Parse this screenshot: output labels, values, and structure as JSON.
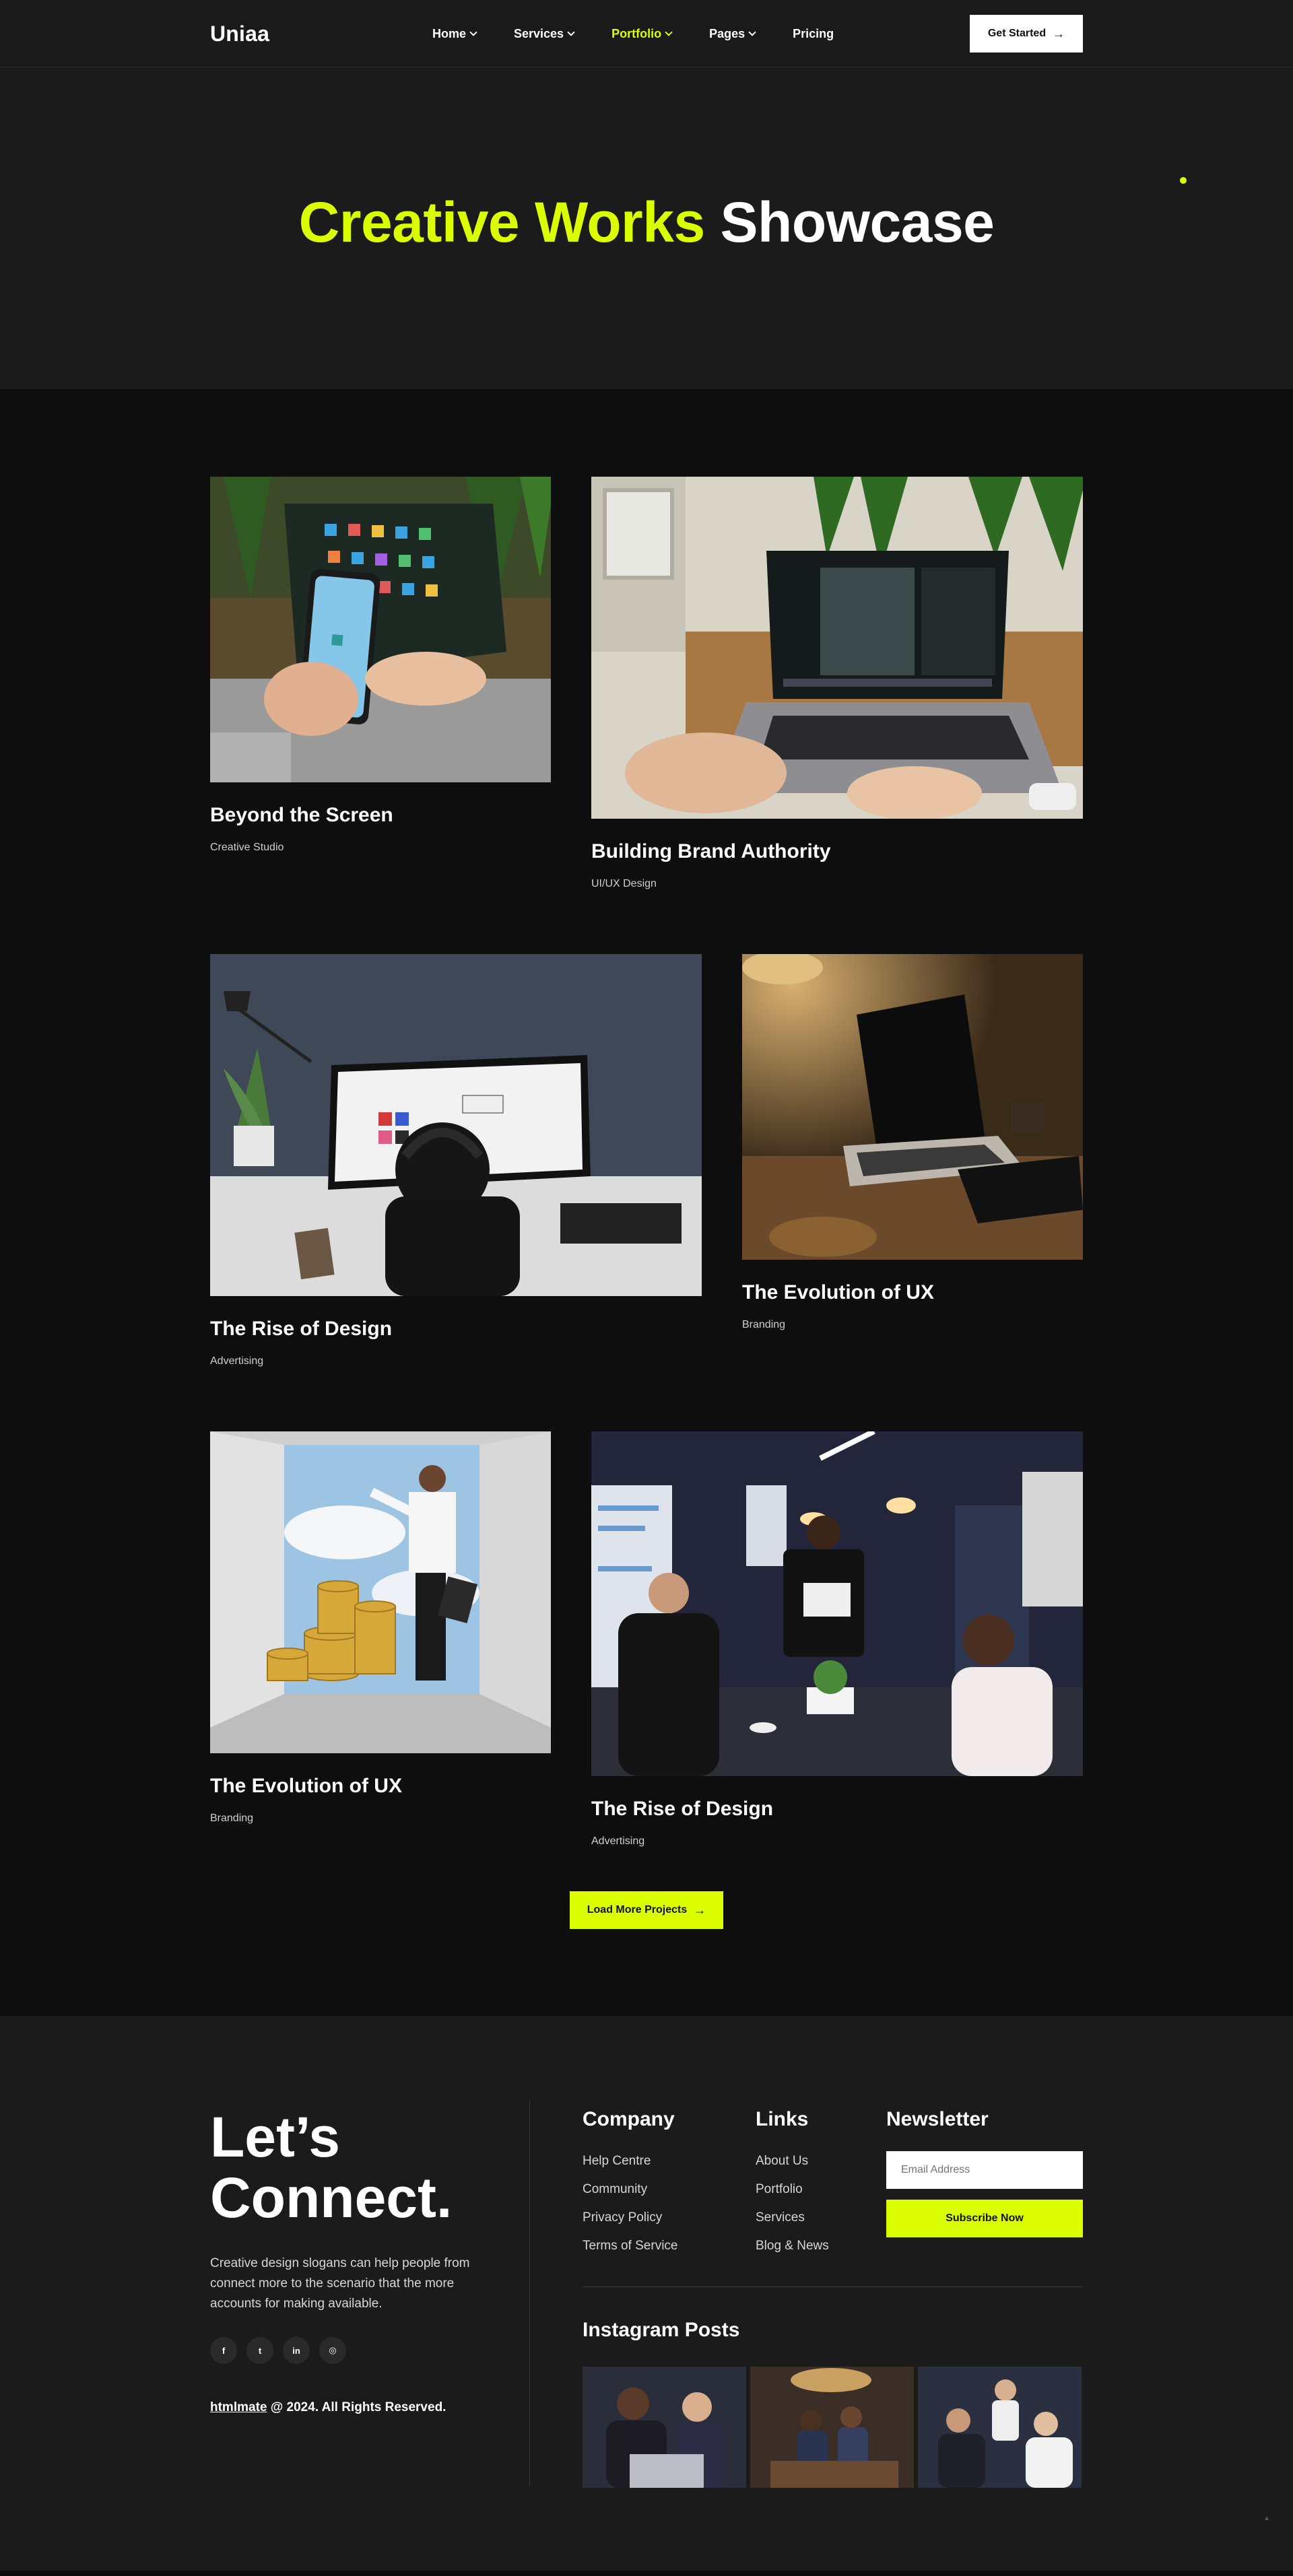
{
  "brand": {
    "logo": "Uniaa",
    "accent": "#dcff00",
    "bg_dark": "#0e0e0e",
    "bg_panel": "#1b1b1b"
  },
  "nav": {
    "items": [
      {
        "label": "Home",
        "dropdown": true,
        "active": false
      },
      {
        "label": "Services",
        "dropdown": true,
        "active": false
      },
      {
        "label": "Portfolio",
        "dropdown": true,
        "active": true
      },
      {
        "label": "Pages",
        "dropdown": true,
        "active": false
      },
      {
        "label": "Pricing",
        "dropdown": false,
        "active": false
      }
    ],
    "cta_label": "Get Started",
    "cta_icon": "arrow-right-icon"
  },
  "hero": {
    "title_accent": "Creative Works",
    "title_rest": "Showcase"
  },
  "portfolio": {
    "projects": [
      {
        "title": "Beyond the Screen",
        "category": "Creative Studio",
        "image": "phone-and-tablet-photo"
      },
      {
        "title": "Building Brand Authority",
        "category": "UI/UX Design",
        "image": "laptop-editing-photo"
      },
      {
        "title": "The Rise of Design",
        "category": "Advertising",
        "image": "designer-at-monitor-photo"
      },
      {
        "title": "The Evolution of UX",
        "category": "Branding",
        "image": "laptop-on-desk-photo"
      },
      {
        "title": "The Evolution of UX",
        "category": "Branding",
        "image": "businessman-door-coins-photo"
      },
      {
        "title": "The Rise of Design",
        "category": "Advertising",
        "image": "office-meeting-photo"
      }
    ],
    "load_more_label": "Load More Projects"
  },
  "footer": {
    "heading_line1": "Let’s",
    "heading_line2": "Connect.",
    "description": "Creative design slogans can help people from connect more to the scenario that the more accounts for making available.",
    "socials": [
      {
        "icon": "facebook-icon",
        "glyph": "f"
      },
      {
        "icon": "twitter-icon",
        "glyph": "t"
      },
      {
        "icon": "linkedin-icon",
        "glyph": "in"
      },
      {
        "icon": "instagram-icon",
        "glyph": "◎"
      }
    ],
    "copyright_brand": "htmlmate",
    "copyright_rest": " @ 2024. All Rights Reserved.",
    "company": {
      "title": "Company",
      "links": [
        "Help Centre",
        "Community",
        "Privacy Policy",
        "Terms of Service"
      ]
    },
    "links": {
      "title": "Links",
      "links": [
        "About Us",
        "Portfolio",
        "Services",
        "Blog & News"
      ]
    },
    "newsletter": {
      "title": "Newsletter",
      "email_placeholder": "Email Address",
      "subscribe_label": "Subscribe Now"
    },
    "instagram": {
      "title": "Instagram Posts",
      "posts": [
        "team-laptop-photo",
        "office-group-photo",
        "meeting-discussion-photo"
      ]
    }
  }
}
